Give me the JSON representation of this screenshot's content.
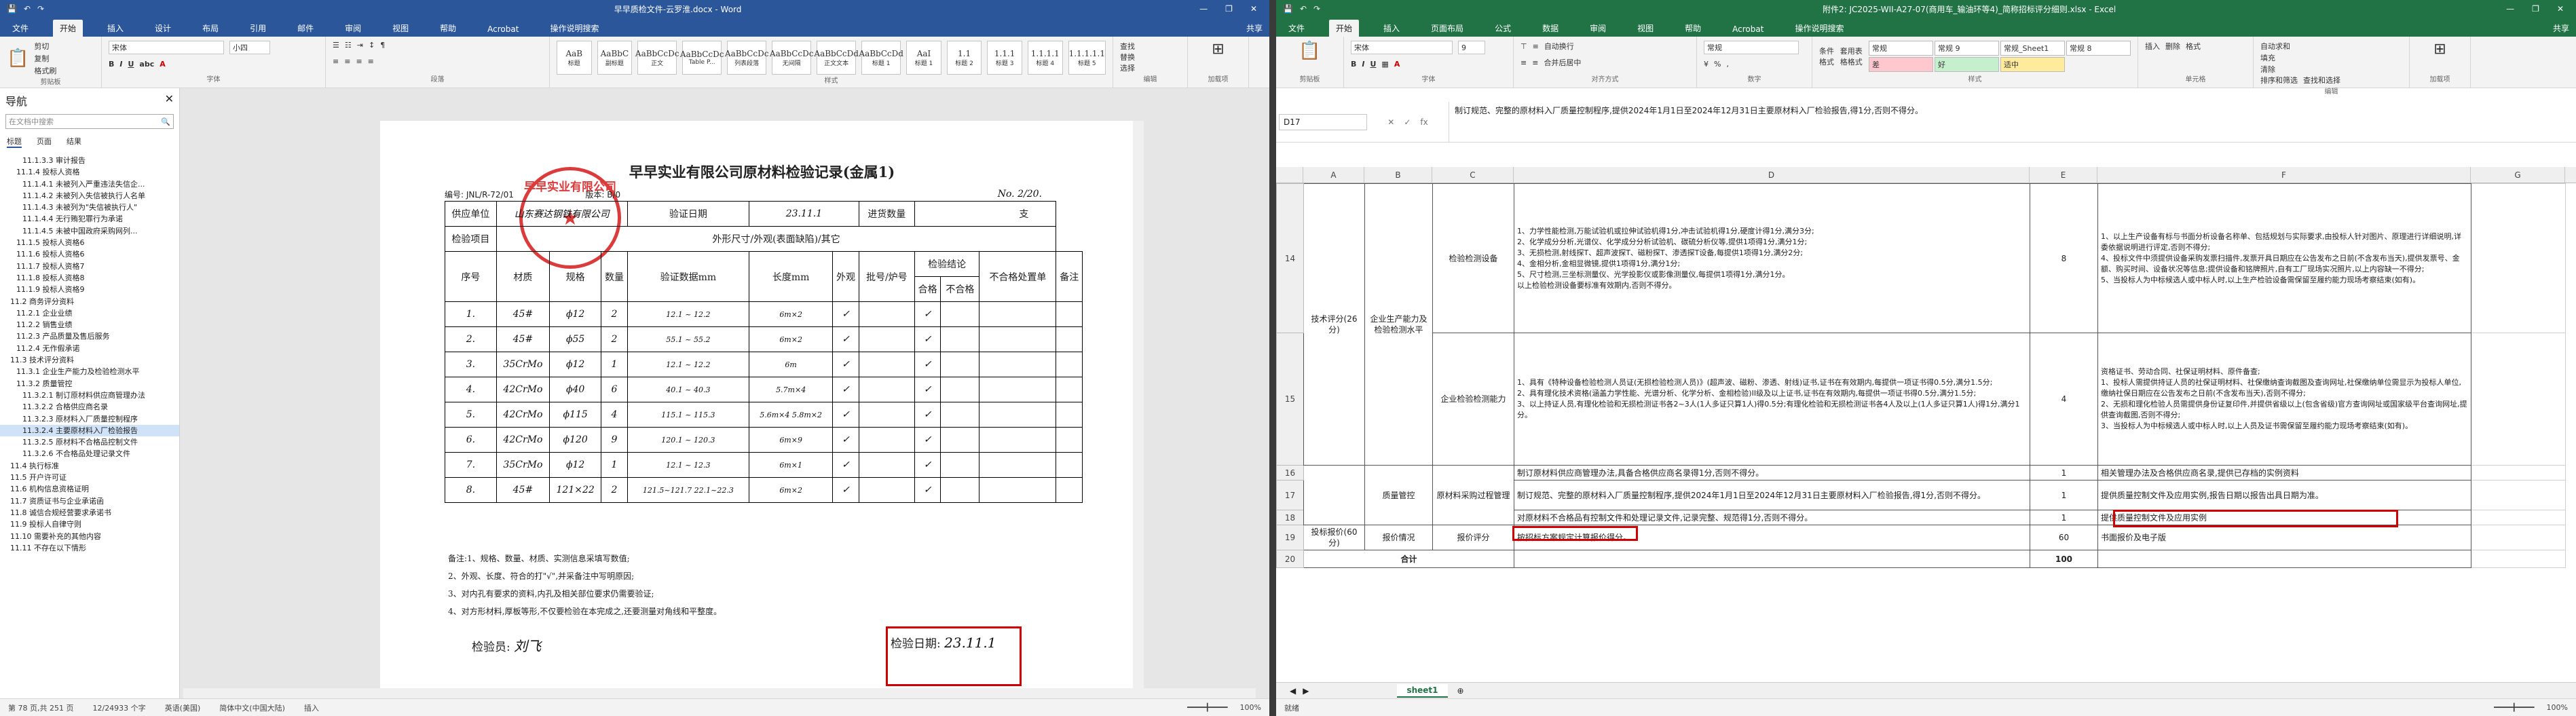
{
  "word": {
    "title": "早早质检文件-云罗淮.docx - Word",
    "tabs": [
      "文件",
      "开始",
      "插入",
      "设计",
      "布局",
      "引用",
      "邮件",
      "审阅",
      "视图",
      "帮助",
      "Acrobat",
      "操作说明搜索"
    ],
    "active_tab": "开始",
    "share": "共享",
    "window_controls": [
      "—",
      "❐",
      "✕"
    ],
    "ribbon": {
      "font_name": "宋体",
      "font_size": "小四",
      "groups": [
        "剪贴板",
        "字体",
        "段落",
        "样式",
        "编辑",
        "加载项"
      ],
      "clipboard": [
        "剪切",
        "复制",
        "格式刷"
      ],
      "paste": "粘贴",
      "styles": [
        {
          "preview": "AaB",
          "name": "标题"
        },
        {
          "preview": "AaBbC",
          "name": "副标题"
        },
        {
          "preview": "AaBbCcDc",
          "name": "正文"
        },
        {
          "preview": "AaBbCcDc",
          "name": "Table P..."
        },
        {
          "preview": "AaBbCcDc",
          "name": "列表段落"
        },
        {
          "preview": "AaBbCcDc",
          "name": "无间隔"
        },
        {
          "preview": "AaBbCcDd",
          "name": "正文文本"
        },
        {
          "preview": "AaBbCcDd",
          "name": "标题 1"
        },
        {
          "preview": "AaI",
          "name": "标题 1"
        },
        {
          "preview": "1.1",
          "name": "标题 2"
        },
        {
          "preview": "1.1.1",
          "name": "标题 3"
        },
        {
          "preview": "1.1.1.1",
          "name": "标题 4"
        },
        {
          "preview": "1.1.1.1.1",
          "name": "标题 5"
        }
      ],
      "editing": [
        "查找",
        "替换",
        "选择"
      ],
      "addins": "加载项"
    },
    "nav": {
      "title": "导航",
      "search_placeholder": "在文档中搜索",
      "tabs": [
        "标题",
        "页面",
        "结果"
      ],
      "items": [
        "11.1.3.3 审计报告",
        "11.1.4 投标人资格",
        "11.1.4.1 未被列入严重违法失信企...",
        "11.1.4.2 未被列入失信被执行人名单",
        "11.1.4.3 未被列为\"失信被执行人\"",
        "11.1.4.4 无行贿犯罪行为承诺",
        "11.1.4.5 未被中国政府采购网列...",
        "11.1.5 投标人资格6",
        "11.1.6 投标人资格6",
        "11.1.7 投标人资格7",
        "11.1.8 投标人资格8",
        "11.1.9 投标人资格9",
        "11.2 商务评分资料",
        "11.2.1 企业业绩",
        "11.2.2 销售业绩",
        "11.2.3 产品质量及售后服务",
        "11.2.4 无作假承诺",
        "11.3 技术评分资料",
        "11.3.1 企业生产能力及检验检测水平",
        "11.3.2 质量管控",
        "11.3.2.1 制订原材料供应商管理办法",
        "11.3.2.2 合格供应商名录",
        "11.3.2.3 原材料入厂质量控制程序",
        "11.3.2.4 主要原材料入厂检验报告",
        "11.3.2.5 原材料不合格品控制文件",
        "11.3.2.6 不合格品处理记录文件",
        "11.4 执行标准",
        "11.5 开户许可证",
        "11.6 机构信息资格证明",
        "11.7 资质证书与企业承诺函",
        "11.8 诚信合规经营要求承诺书",
        "11.9 投标人自律守则",
        "11.10 需要补充的其他内容",
        "11.11 不存在以下情形"
      ],
      "selected_index": 23
    },
    "doc": {
      "title": "早早实业有限公司原材料检验记录(金属1)",
      "code": "编号: JNL/R-72/01",
      "version": "版本: B/0",
      "no": "No. 2/20.",
      "header_row": {
        "supplier_label": "供应单位",
        "supplier_value": "山东赛达钢铁有限公司",
        "date_label": "验证日期",
        "date_value": "23.11.1",
        "qty_label": "进货数量",
        "qty_unit": "支"
      },
      "item_row": {
        "label": "检验项目",
        "value": "外形尺寸/外观(表面缺陷)/其它"
      },
      "columns": [
        "序号",
        "材质",
        "规格",
        "数量",
        "验证数据mm",
        "长度mm",
        "外观",
        "批号/炉号",
        "检验结论",
        "不合格处置单",
        "备注"
      ],
      "subcolumns": [
        "合格",
        "不合格"
      ],
      "rows": [
        {
          "no": "1.",
          "mat": "45#",
          "spec": "ϕ12",
          "qty": "2",
          "data": "12.1 ~ 12.2",
          "len": "6m×2",
          "look": "✓",
          "batch": "",
          "ok": "✓"
        },
        {
          "no": "2.",
          "mat": "45#",
          "spec": "ϕ55",
          "qty": "2",
          "data": "55.1 ~ 55.2",
          "len": "6m×2",
          "look": "✓",
          "batch": "",
          "ok": "✓"
        },
        {
          "no": "3.",
          "mat": "35CrMo",
          "spec": "ϕ12",
          "qty": "1",
          "data": "12.1 ~ 12.2",
          "len": "6m",
          "look": "✓",
          "batch": "",
          "ok": "✓"
        },
        {
          "no": "4.",
          "mat": "42CrMo",
          "spec": "ϕ40",
          "qty": "6",
          "data": "40.1 ~ 40.3",
          "len": "5.7m×4",
          "look": "✓",
          "batch": "",
          "ok": "✓"
        },
        {
          "no": "5.",
          "mat": "42CrMo",
          "spec": "ϕ115",
          "qty": "4",
          "data": "115.1 ~ 115.3",
          "len": "5.6m×4 5.8m×2",
          "look": "✓",
          "batch": "",
          "ok": "✓"
        },
        {
          "no": "6.",
          "mat": "42CrMo",
          "spec": "ϕ120",
          "qty": "9",
          "data": "120.1 ~ 120.3",
          "len": "6m×9",
          "look": "✓",
          "batch": "",
          "ok": "✓"
        },
        {
          "no": "7.",
          "mat": "35CrMo",
          "spec": "ϕ12",
          "qty": "1",
          "data": "12.1 ~ 12.3",
          "len": "6m×1",
          "look": "✓",
          "batch": "",
          "ok": "✓"
        },
        {
          "no": "8.",
          "mat": "45#",
          "spec": "121×22",
          "qty": "2",
          "data": "121.5~121.7 22.1~22.3",
          "len": "6m×2",
          "look": "✓",
          "batch": "",
          "ok": "✓"
        }
      ],
      "notes": [
        "备注:1、规格、数量、材质、实测信息采填写数值;",
        "2、外观、长度、符合的打\"√\",并采备注中写明原因;",
        "3、对内孔有要求的资料,内孔及相关部位要求仍需要验证;",
        "4、对方形材料,厚板等形,不仅要检验在本完成之,还要测量对角线和平整度。"
      ],
      "inspector_label": "检验员:",
      "inspector_value": "刘飞",
      "date_label": "检验日期:",
      "date_value": "23.11.1",
      "stamp_text": "早早实业有限公司",
      "stamp_center": "★"
    },
    "status": {
      "page": "第 78 页,共 251 页",
      "words": "12/24933 个字",
      "lang": "英语(美国)",
      "lang2": "简体中文(中国大陆)",
      "insert": "插入",
      "zoom": "100%"
    }
  },
  "excel": {
    "title": "附件2: JC2025-WII-A27-07(商用车_输油环等4)_简称招标评分细则.xlsx - Excel",
    "tabs": [
      "文件",
      "开始",
      "插入",
      "页面布局",
      "公式",
      "数据",
      "审阅",
      "视图",
      "帮助",
      "Acrobat",
      "操作说明搜索"
    ],
    "active_tab": "开始",
    "share": "共享",
    "window_controls": [
      "—",
      "❐",
      "✕"
    ],
    "ribbon": {
      "font_name": "宋体",
      "font_size": "9",
      "wrap": "自动换行",
      "merge": "合并后居中",
      "number_format": "常规",
      "groups": [
        "剪贴板",
        "字体",
        "对齐方式",
        "数字",
        "样式",
        "单元格",
        "编辑",
        "加载项"
      ],
      "cond_format": "条件格式",
      "as_table": "套用表格格式",
      "styles": [
        {
          "name": "常规",
          "bg": "#ffffff"
        },
        {
          "name": "常规 9",
          "bg": "#ffffff"
        },
        {
          "name": "常规_Sheet1",
          "bg": "#ffffff"
        },
        {
          "name": "常规 8",
          "bg": "#ffffff"
        },
        {
          "name": "差",
          "bg": "#ffc7ce"
        },
        {
          "name": "好",
          "bg": "#c6efce"
        },
        {
          "name": "适中",
          "bg": "#ffeb9c"
        }
      ],
      "cells": [
        "插入",
        "删除",
        "格式"
      ],
      "editing": [
        "自动求和",
        "填充",
        "清除",
        "排序和筛选",
        "查找和选择"
      ],
      "addins": "加载项"
    },
    "namebox": "D17",
    "formula": "制订规范、完整的原材料入厂质量控制程序,提供2024年1月1日至2024年12月31日主要原材料入厂检验报告,得1分,否则不得分。",
    "columns": [
      "A",
      "B",
      "C",
      "D",
      "E",
      "F",
      "G"
    ],
    "rows": {
      "r14_label": "14",
      "r15_label": "15",
      "r16_label": "16",
      "r17_label": "17",
      "r18_label": "18",
      "r19_label": "19",
      "r20_label": "20",
      "tech_group": "技术评分(26分)",
      "capacity": "企业生产能力及检验检测水平",
      "equip": "检验检测设备",
      "equip_desc": "1、力学性能检测,万能试验机或拉伸试验机得1分,冲击试验机得1分,硬度计得1分,满分3分;\n2、化学成分分析,光谱仪、化学成分分析试验机、碳硫分析仪等,提供1项得1分,满分1分;\n3、无损检测,射线探T、超声波探T、磁粉探T、渗透探T设备,每提供1项得1分,满分2分;\n4、金相分析,金相显微镜,提供1项得1分,满分1分;\n5、尺寸检测,三坐标测量仪、光学投影仪或影像测量仪,每提供1项得1分,满分1分。\n以上检验检测设备要标准有效期内,否则不得分。",
      "equip_score": "8",
      "equip_req": "1、以上生产设备有标与书面分析设备名称单、包括规划与实际要求,由投标人针对图片、原理进行详细说明,详委依据说明进行评定,否则不得分;\n4、投标文件中须提供设备采购发票扫描件,发票开具日期应在公告发布之日前(不含发布当天),提供发票号、金额、购买时间、设备状况等信息;提供设备和铭牌照片,自有工厂现场实况照片,以上内容缺一不得分;\n5、当投标人为中标候选人或中标人时,以上生产检验设备需保留至履约能力现场考察结束(如有)。",
      "person": "企业检验检测能力",
      "person_desc": "1、具有《特种设备检验检测人员证(无损检验检测人员)》(超声波、磁粉、渗透、射线)证书,证书在有效期内,每提供一项证书得0.5分,满分1.5分;\n2、具有理化技术资格(涵盖力学性能、光谱分析、化学分析、金相检验)II级及以上证书,证书在有效期内,每提供一项证书得0.5分,满分1.5分;\n3、以上持证人员,有理化检验和无损检测证书各2~3人(1人多证只算1人)得0.5分;有理化检验和无损检测证书各4人及以上(1人多证只算1人)得1分,满分1分。",
      "person_score": "4",
      "person_req": "资格证书、劳动合同、社保证明材料、原件备查;\n1、投标人需提供持证人员的社保证明材料、社保缴纳查询截图及查询网址,社保缴纳单位需显示为投标人单位,缴纳社保日期应在公告发布之日前(不含发布当天),否则不得分;\n2、无损和理化检验人员需提供身份证复印件,并提供省级以上(包含省级)官方查询网址或国家级平台查询网址,提供查询截图,否则不得分;\n3、当投标人为中标候选人或中标人时,以上人员及证书需保留至履约能力现场考察结束(如有)。",
      "qc": "质量管控",
      "raw": "原材料采购过程管理",
      "r16_desc": "制订原材料供应商管理办法,具备合格供应商名录得1分,否则不得分。",
      "r16_score": "1",
      "r16_req": "相关管理办法及合格供应商名录,提供已存档的实例资料",
      "r17_desc_a": "制订规范、完整的原材料入厂质量控制程序,",
      "r17_desc_b": "提供2024年1月1日至2024年12月31日主要原材料入厂检验报告,得1分,否则不得分。",
      "r17_score": "1",
      "r17_req": "提供质量控制文件及应用实例,报告日期以报告出具日期为准。",
      "r18_desc": "对原材料不合格品有控制文件和处理记录文件,记录完整、规范得1分,否则不得分。",
      "r18_score": "1",
      "r18_req": "提供质量控制文件及应用实例",
      "price_group": "投标报价(60分)",
      "price": "报价情况",
      "price_item": "报价评分",
      "price_desc": "按招标方案规定计算报价得分。",
      "price_score": "60",
      "price_req": "书面报价及电子版",
      "total": "合计",
      "total_score": "100"
    },
    "sheet_tab": "sheet1",
    "status": {
      "ready": "就绪",
      "zoom": "100%"
    }
  }
}
